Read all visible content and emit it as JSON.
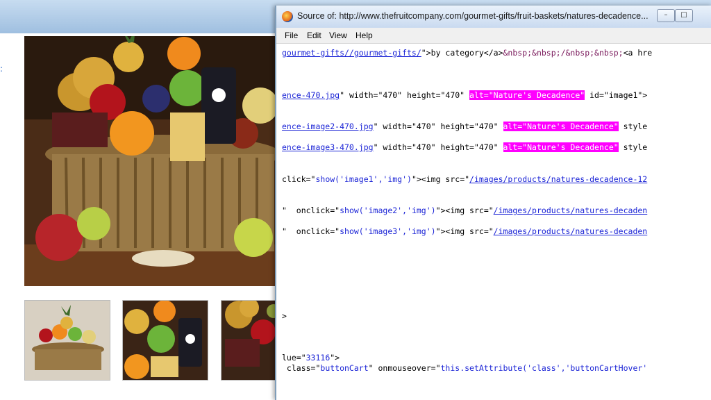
{
  "window": {
    "title": "Source of: http://www.thefruitcompany.com/gourmet-gifts/fruit-baskets/natures-decadence...",
    "buttons": [
      "–",
      "□"
    ]
  },
  "menu": [
    "File",
    "Edit",
    "View",
    "Help"
  ],
  "source_lines": {
    "l1": {
      "link": "gourmet-gifts//gourmet-gifts/",
      "rest1": "\">by category</a>",
      "ent": "&nbsp;&nbsp;/&nbsp;&nbsp;",
      "rest2": "<a hre"
    },
    "l2": {
      "link": "ence-470.jpg",
      "mid": "\" width=\"470\" height=\"470\" ",
      "hl": "alt=\"Nature's Decadence\"",
      "end": " id=\"image1\">"
    },
    "l3": {
      "link": "ence-image2-470.jpg",
      "mid": "\" width=\"470\" height=\"470\" ",
      "hl": "alt=\"Nature's Decadence\"",
      "end": " style"
    },
    "l4": {
      "link": "ence-image3-470.jpg",
      "mid": "\" width=\"470\" height=\"470\" ",
      "hl": "alt=\"Nature's Decadence\"",
      "end": " style"
    },
    "l5": {
      "a": "click=\"",
      "str": "show('image1','img')",
      "b": "\"><img src=\"",
      "link": "/images/products/natures-decadence-12"
    },
    "l6": {
      "a": "\"  onclick=\"",
      "str": "show('image2','img')",
      "b": "\"><img src=\"",
      "link": "/images/products/natures-decaden"
    },
    "l7": {
      "a": "\"  onclick=\"",
      "str": "show('image3','img')",
      "b": "\"><img src=\"",
      "link": "/images/products/natures-decaden"
    },
    "l8": {
      "text": ">"
    },
    "l9": {
      "a": "lue=\"",
      "str": "33116",
      "b": "\">"
    },
    "l10": {
      "a": " class=\"",
      "str": "buttonCart",
      "b": "\" onmouseover=\"",
      "str2": "this.setAttribute('class','buttonCartHover'"
    }
  },
  "colors": {
    "highlight": "#ff00ff",
    "link": "#1b24d6",
    "tag": "#7a1a5c"
  }
}
